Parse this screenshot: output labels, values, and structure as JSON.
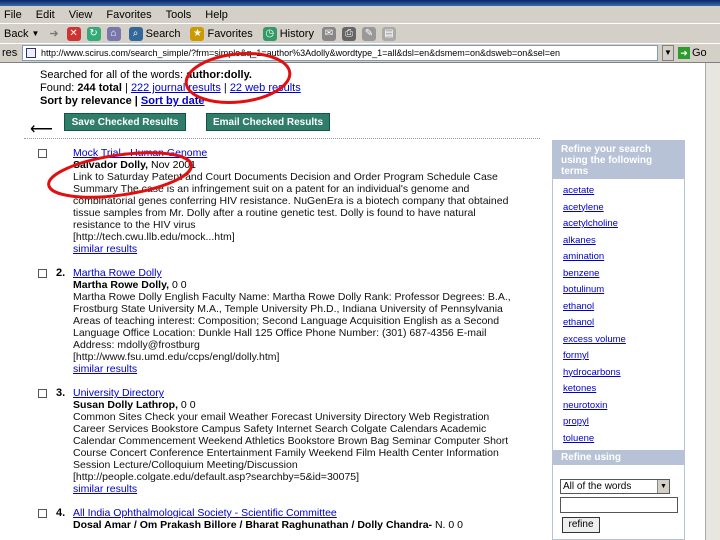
{
  "menu": {
    "items": [
      "File",
      "Edit",
      "View",
      "Favorites",
      "Tools",
      "Help"
    ]
  },
  "toolbar": {
    "back_label": "Back",
    "search_label": "Search",
    "favorites_label": "Favorites",
    "history_label": "History"
  },
  "address": {
    "label": "ress",
    "url": "http://www.scirus.com/search_simple/?frm=simple&q_1=author%3Adolly&wordtype_1=all&dsl=en&dsmem=on&dsweb=on&sel=en",
    "go_label": "Go"
  },
  "summary": {
    "searched_prefix": "Searched for all of the words: ",
    "query": "author:dolly.",
    "found_prefix": "Found: ",
    "found_total": "244 total",
    "journal_link": "222 journal results",
    "web_link": "22 web results",
    "sort_prefix": "Sort by relevance",
    "sort_date_link": "Sort by date",
    "separator": "|"
  },
  "actions": {
    "save_checked": "Save Checked Results",
    "email_checked": "Email Checked Results"
  },
  "results": [
    {
      "num": "",
      "title": "Mock Trial - Human Genome",
      "authors": "Salvador Dolly,",
      "date": " Nov 2001",
      "desc_1": "Link to Saturday Patent and Court Documents Decision and Order Program Schedule Case",
      "desc_2": "Summary The case is an infringement suit on a patent for an individual's genome and",
      "desc_3": "combinatorial genes conferring HIV resistance. NuGenEra is a biotech company that obtained",
      "desc_4": "tissue samples from Mr. Dolly after a routine genetic test. Dolly is found to have natural",
      "desc_5": "resistance to the HIV virus",
      "url": "[http://tech.cwu.llb.edu/mock...htm]",
      "similar": "similar results"
    },
    {
      "num": "2.",
      "title": "Martha Rowe Dolly",
      "authors": "Martha Rowe Dolly,",
      "date": " 0 0",
      "desc_1": "Martha Rowe Dolly English Faculty Name: Martha Rowe Dolly Rank: Professor Degrees: B.A.,",
      "desc_2": "Frostburg State University M.A., Temple University Ph.D., Indiana University of Pennsylvania",
      "desc_3": "Areas of teaching interest: Composition; Second Language Acquisition English as a Second",
      "desc_4": "Language Office Location: Dunkle Hall 125 Office Phone Number: (301) 687-4356 E-mail",
      "desc_5": "Address: mdolly@frostburg",
      "url": "[http://www.fsu.umd.edu/ccps/engl/dolly.htm]",
      "similar": "similar results"
    },
    {
      "num": "3.",
      "title": "University Directory",
      "authors": "Susan Dolly Lathrop,",
      "date": " 0 0",
      "desc_1": "Common Sites Check your email Weather Forecast University Directory Web Registration",
      "desc_2": "Career Services Bookstore Campus Safety Internet Search Colgate Calendars Academic",
      "desc_3": "Calendar Commencement Weekend Athletics Bookstore Brown Bag Seminar Computer Short",
      "desc_4": "Course Concert Conference Entertainment Family Weekend Film Health Center Information",
      "desc_5": "Session Lecture/Colloquium Meeting/Discussion",
      "url": "[http://people.colgate.edu/default.asp?searchby=5&id=30075]",
      "similar": "similar results"
    },
    {
      "num": "4.",
      "title": "All India Ophthalmological Society - Scientific Committee",
      "authors": "Dosal Amar / Om Prakash Billore / Bharat Raghunathan / Dolly Chandra-",
      "date": " N. 0 0"
    }
  ],
  "sidebar": {
    "heading": "Refine your search using the following terms",
    "terms": [
      "acetate",
      "acetylene",
      "acetylcholine",
      "alkanes",
      "amination",
      "benzene",
      "botulinum",
      "ethanol",
      "ethanol",
      "excess volume",
      "formyl",
      "hydrocarbons",
      "ketones",
      "neurotoxin",
      "propyl",
      "toluene"
    ]
  },
  "refine": {
    "heading": "Refine using",
    "select_value": "All of the words",
    "button_label": "refine"
  },
  "colors": {
    "button_green": "#2f7d6a",
    "sidebar_blue": "#b7c2d6",
    "link_blue": "#0000cc",
    "annotation_red": "#e01010"
  }
}
